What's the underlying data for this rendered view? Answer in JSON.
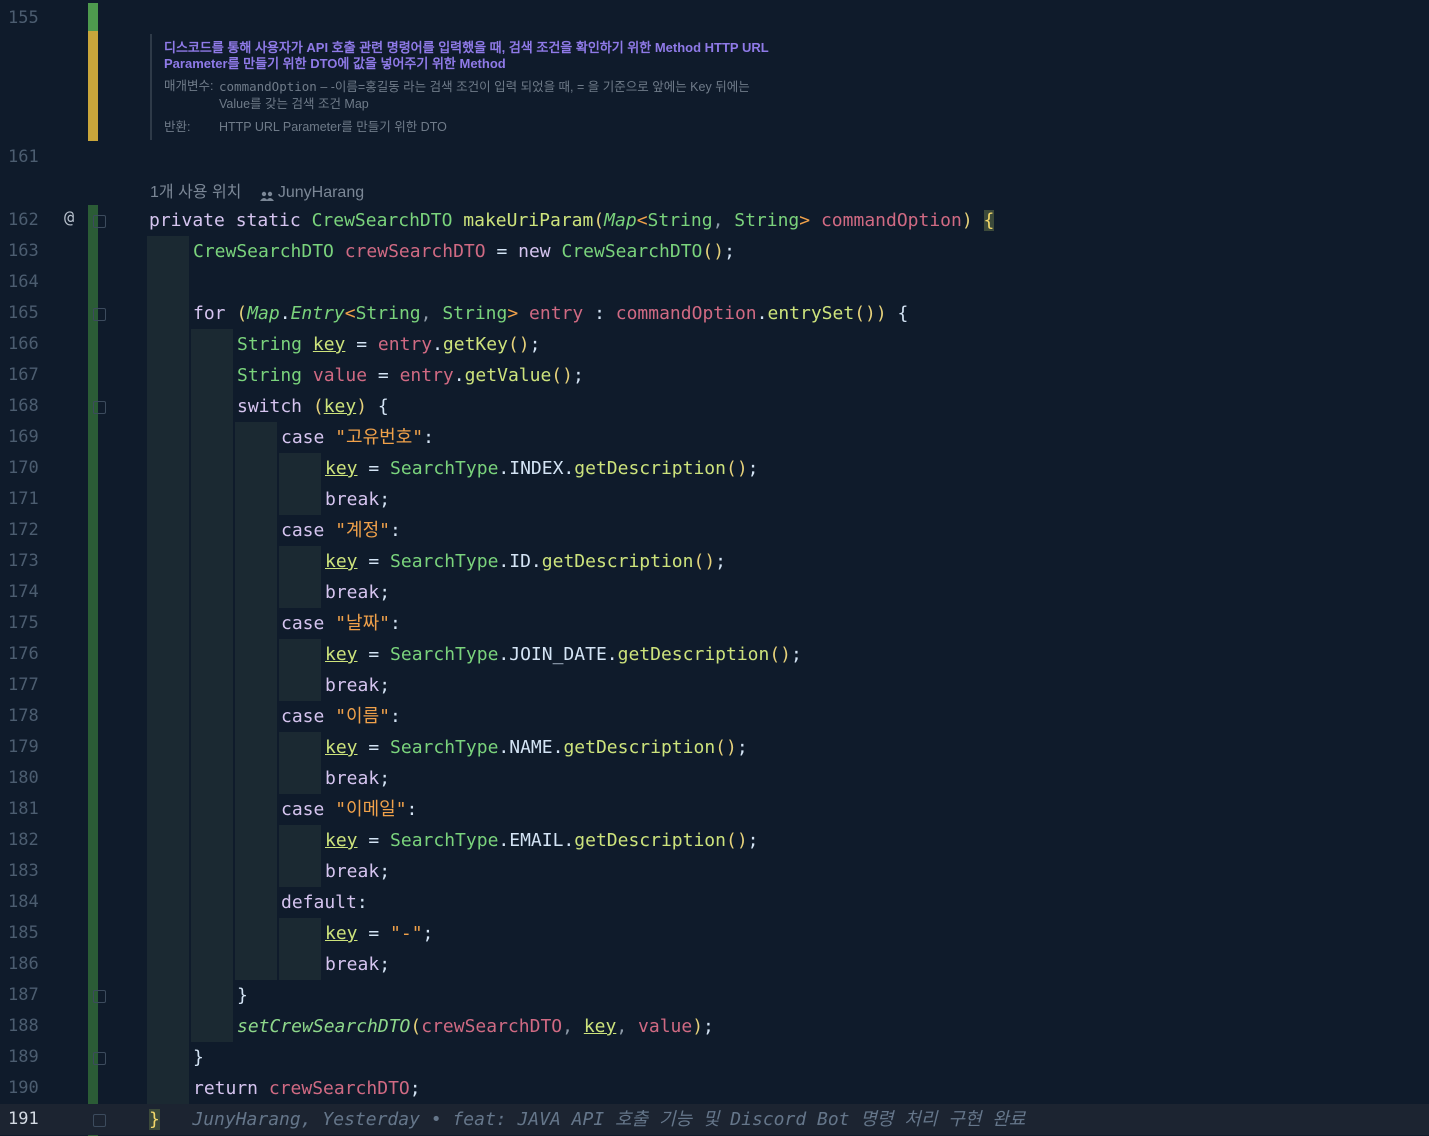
{
  "colors": {
    "background": "#0f1b2b",
    "keyword": "#d5c4ef",
    "type": "#7ad37c",
    "string": "#f0a14a",
    "param": "#d06a83",
    "doc_accent": "#8f7ae8"
  },
  "doc": {
    "line_number": "155",
    "description": "디스코드를 통해 사용자가 API 호출 관련 명령어를 입력했을 때, 검색 조건을 확인하기 위한 Method HTTP URL Parameter를 만들기 위한 DTO에 값을 넣어주기 위한 Method",
    "param_label": "매개변수:",
    "param_name": "commandOption",
    "param_desc": " – -이름=홍길동 라는 검색 조건이 입력 되었을 때, = 을 기준으로 앞에는 Key 뒤에는 Value를 갖는 검색 조건 Map",
    "return_label": "반환:",
    "return_desc": "HTTP URL Parameter를 만들기 위한 DTO"
  },
  "blank_line_number": "161",
  "inlay": {
    "usages": "1개 사용 위치",
    "author": "JunyHarang",
    "user_icon": "users-icon",
    "annotation_icon": "at-icon"
  },
  "lines": [
    {
      "n": "162",
      "parts": [
        [
          "kw",
          "private static "
        ],
        [
          "ty",
          "CrewSearchDTO "
        ],
        [
          "mt",
          "makeUriParam"
        ],
        [
          "paren",
          "("
        ],
        [
          "ty it",
          "Map"
        ],
        [
          "gen",
          "<"
        ],
        [
          "ty",
          "String"
        ],
        [
          "dim",
          ", "
        ],
        [
          "ty",
          "String"
        ],
        [
          "gen",
          "> "
        ],
        [
          "pr",
          "commandOption"
        ],
        [
          "paren",
          ") "
        ],
        [
          "brace-hl",
          "{"
        ]
      ]
    },
    {
      "n": "163",
      "parts": [
        [
          "ty",
          "CrewSearchDTO "
        ],
        [
          "pr",
          "crewSearchDTO "
        ],
        [
          "cs",
          "= "
        ],
        [
          "kw",
          "new "
        ],
        [
          "ty",
          "CrewSearchDTO"
        ],
        [
          "paren",
          "()"
        ],
        [
          "cs",
          ";"
        ]
      ]
    },
    {
      "n": "164",
      "parts": []
    },
    {
      "n": "165",
      "parts": [
        [
          "kw",
          "for "
        ],
        [
          "paren",
          "("
        ],
        [
          "ty it",
          "Map"
        ],
        [
          "cs",
          "."
        ],
        [
          "ty it",
          "Entry"
        ],
        [
          "gen",
          "<"
        ],
        [
          "ty",
          "String"
        ],
        [
          "dim",
          ", "
        ],
        [
          "ty",
          "String"
        ],
        [
          "gen",
          "> "
        ],
        [
          "pr",
          "entry "
        ],
        [
          "cs",
          ": "
        ],
        [
          "pr",
          "commandOption"
        ],
        [
          "cs",
          "."
        ],
        [
          "mt",
          "entrySet"
        ],
        [
          "paren",
          "()) "
        ],
        [
          "cs",
          "{"
        ]
      ]
    },
    {
      "n": "166",
      "parts": [
        [
          "ty",
          "String "
        ],
        [
          "mt un",
          "key"
        ],
        [
          "cs",
          " = "
        ],
        [
          "pr",
          "entry"
        ],
        [
          "cs",
          "."
        ],
        [
          "mt",
          "getKey"
        ],
        [
          "paren",
          "()"
        ],
        [
          "cs",
          ";"
        ]
      ]
    },
    {
      "n": "167",
      "parts": [
        [
          "ty",
          "String "
        ],
        [
          "pr",
          "value"
        ],
        [
          "cs",
          " = "
        ],
        [
          "pr",
          "entry"
        ],
        [
          "cs",
          "."
        ],
        [
          "mt",
          "getValue"
        ],
        [
          "paren",
          "()"
        ],
        [
          "cs",
          ";"
        ]
      ]
    },
    {
      "n": "168",
      "parts": [
        [
          "kw",
          "switch "
        ],
        [
          "paren",
          "("
        ],
        [
          "mt un",
          "key"
        ],
        [
          "paren",
          ") "
        ],
        [
          "cs",
          "{"
        ]
      ]
    },
    {
      "n": "169",
      "parts": [
        [
          "kw",
          "case "
        ],
        [
          "st",
          "\"고유번호\""
        ],
        [
          "cs",
          ":"
        ]
      ]
    },
    {
      "n": "170",
      "parts": [
        [
          "mt un",
          "key"
        ],
        [
          "cs",
          " = "
        ],
        [
          "ty",
          "SearchType"
        ],
        [
          "cs",
          ".INDEX."
        ],
        [
          "mt",
          "getDescription"
        ],
        [
          "paren",
          "()"
        ],
        [
          "cs",
          ";"
        ]
      ]
    },
    {
      "n": "171",
      "parts": [
        [
          "kw",
          "break"
        ],
        [
          "cs",
          ";"
        ]
      ]
    },
    {
      "n": "172",
      "parts": [
        [
          "kw",
          "case "
        ],
        [
          "st",
          "\"계정\""
        ],
        [
          "cs",
          ":"
        ]
      ]
    },
    {
      "n": "173",
      "parts": [
        [
          "mt un",
          "key"
        ],
        [
          "cs",
          " = "
        ],
        [
          "ty",
          "SearchType"
        ],
        [
          "cs",
          ".ID."
        ],
        [
          "mt",
          "getDescription"
        ],
        [
          "paren",
          "()"
        ],
        [
          "cs",
          ";"
        ]
      ]
    },
    {
      "n": "174",
      "parts": [
        [
          "kw",
          "break"
        ],
        [
          "cs",
          ";"
        ]
      ]
    },
    {
      "n": "175",
      "parts": [
        [
          "kw",
          "case "
        ],
        [
          "st",
          "\"날짜\""
        ],
        [
          "cs",
          ":"
        ]
      ]
    },
    {
      "n": "176",
      "parts": [
        [
          "mt un",
          "key"
        ],
        [
          "cs",
          " = "
        ],
        [
          "ty",
          "SearchType"
        ],
        [
          "cs",
          ".JOIN_DATE."
        ],
        [
          "mt",
          "getDescription"
        ],
        [
          "paren",
          "()"
        ],
        [
          "cs",
          ";"
        ]
      ]
    },
    {
      "n": "177",
      "parts": [
        [
          "kw",
          "break"
        ],
        [
          "cs",
          ";"
        ]
      ]
    },
    {
      "n": "178",
      "parts": [
        [
          "kw",
          "case "
        ],
        [
          "st",
          "\"이름\""
        ],
        [
          "cs",
          ":"
        ]
      ]
    },
    {
      "n": "179",
      "parts": [
        [
          "mt un",
          "key"
        ],
        [
          "cs",
          " = "
        ],
        [
          "ty",
          "SearchType"
        ],
        [
          "cs",
          ".NAME."
        ],
        [
          "mt",
          "getDescription"
        ],
        [
          "paren",
          "()"
        ],
        [
          "cs",
          ";"
        ]
      ]
    },
    {
      "n": "180",
      "parts": [
        [
          "kw",
          "break"
        ],
        [
          "cs",
          ";"
        ]
      ]
    },
    {
      "n": "181",
      "parts": [
        [
          "kw",
          "case "
        ],
        [
          "st",
          "\"이메일\""
        ],
        [
          "cs",
          ":"
        ]
      ]
    },
    {
      "n": "182",
      "parts": [
        [
          "mt un",
          "key"
        ],
        [
          "cs",
          " = "
        ],
        [
          "ty",
          "SearchType"
        ],
        [
          "cs",
          ".EMAIL."
        ],
        [
          "mt",
          "getDescription"
        ],
        [
          "paren",
          "()"
        ],
        [
          "cs",
          ";"
        ]
      ]
    },
    {
      "n": "183",
      "parts": [
        [
          "kw",
          "break"
        ],
        [
          "cs",
          ";"
        ]
      ]
    },
    {
      "n": "184",
      "parts": [
        [
          "kw",
          "default"
        ],
        [
          "cs",
          ":"
        ]
      ]
    },
    {
      "n": "185",
      "parts": [
        [
          "mt un",
          "key"
        ],
        [
          "cs",
          " = "
        ],
        [
          "st",
          "\"-\""
        ],
        [
          "cs",
          ";"
        ]
      ]
    },
    {
      "n": "186",
      "parts": [
        [
          "kw",
          "break"
        ],
        [
          "cs",
          ";"
        ]
      ]
    },
    {
      "n": "187",
      "parts": [
        [
          "cs",
          "}"
        ]
      ]
    },
    {
      "n": "188",
      "parts": [
        [
          "fn it",
          "setCrewSearchDTO"
        ],
        [
          "paren",
          "("
        ],
        [
          "pr",
          "crewSearchDTO"
        ],
        [
          "dim",
          ", "
        ],
        [
          "mt un",
          "key"
        ],
        [
          "dim",
          ", "
        ],
        [
          "pr",
          "value"
        ],
        [
          "paren",
          ")"
        ],
        [
          "cs",
          ";"
        ]
      ]
    },
    {
      "n": "189",
      "parts": [
        [
          "cs",
          "}"
        ]
      ]
    },
    {
      "n": "190",
      "parts": [
        [
          "kw",
          "return "
        ],
        [
          "pr",
          "crewSearchDTO"
        ],
        [
          "cs",
          ";"
        ]
      ]
    },
    {
      "n": "191",
      "parts": [
        [
          "brace-hl",
          "}"
        ],
        [
          "blame",
          "   JunyHarang, Yesterday • feat: JAVA API 호출 기능 및 Discord Bot 명령 처리 구현 완료"
        ]
      ]
    }
  ]
}
